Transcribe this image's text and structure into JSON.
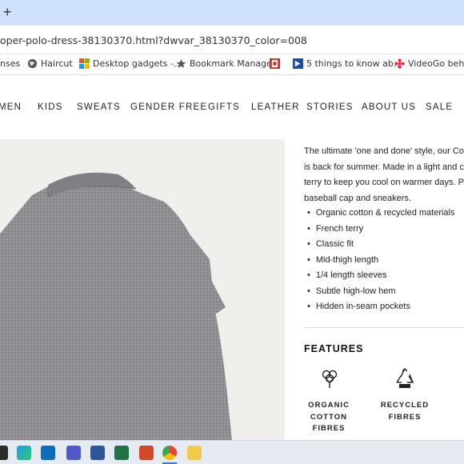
{
  "browser": {
    "new_tab_symbol": "+",
    "url": "oper-polo-dress-38130370.html?dwvar_38130370_color=008",
    "bookmarks": [
      {
        "label": "nses",
        "icon": "none"
      },
      {
        "label": "Haircut",
        "icon": "globe-icon"
      },
      {
        "label": "Desktop gadgets -...",
        "icon": "windows-logo-icon"
      },
      {
        "label": "Bookmark Manager",
        "icon": "star-icon"
      },
      {
        "label": "",
        "icon": "maple-leaf-icon"
      },
      {
        "label": "5 things to know ab...",
        "icon": "flag-icon"
      },
      {
        "label": "VideoGo behind",
        "icon": "cbc-icon"
      }
    ]
  },
  "nav": {
    "items": [
      "MEN",
      "KIDS",
      "SWEATS",
      "GENDER FREE",
      "GIFTS",
      "LEATHER",
      "STORIES",
      "ABOUT US",
      "SALE"
    ]
  },
  "product": {
    "description_lines": [
      "The ultimate 'one and done' style, our Co",
      "is back for summer. Made in a light and c",
      "terry to keep you cool on warmer days. P",
      "baseball cap and sneakers."
    ],
    "bullets": [
      "Organic cotton & recycled materials",
      "French terry",
      "Classic fit",
      "Mid-thigh length",
      "1/4 length sleeves",
      "Subtle high-low hem",
      "Hidden in-seam pockets"
    ],
    "features_title": "FEATURES",
    "features": [
      {
        "icon": "cotton-plant-icon",
        "label": "ORGANIC COTTON FIBRES"
      },
      {
        "icon": "recycle-icon",
        "label": "RECYCLED FIBRES"
      }
    ]
  },
  "colors": {
    "tab_strip": "#cfe0fb",
    "hero_background": "#f1efec",
    "shirt": "#8f8f93",
    "taskbar": "#e6ebf2"
  },
  "taskbar": {
    "icons": [
      "search-icon",
      "edge-icon",
      "outlook-icon",
      "teams-icon",
      "word-icon",
      "excel-icon",
      "powerpoint-icon",
      "chrome-icon",
      "file-explorer-icon"
    ]
  }
}
